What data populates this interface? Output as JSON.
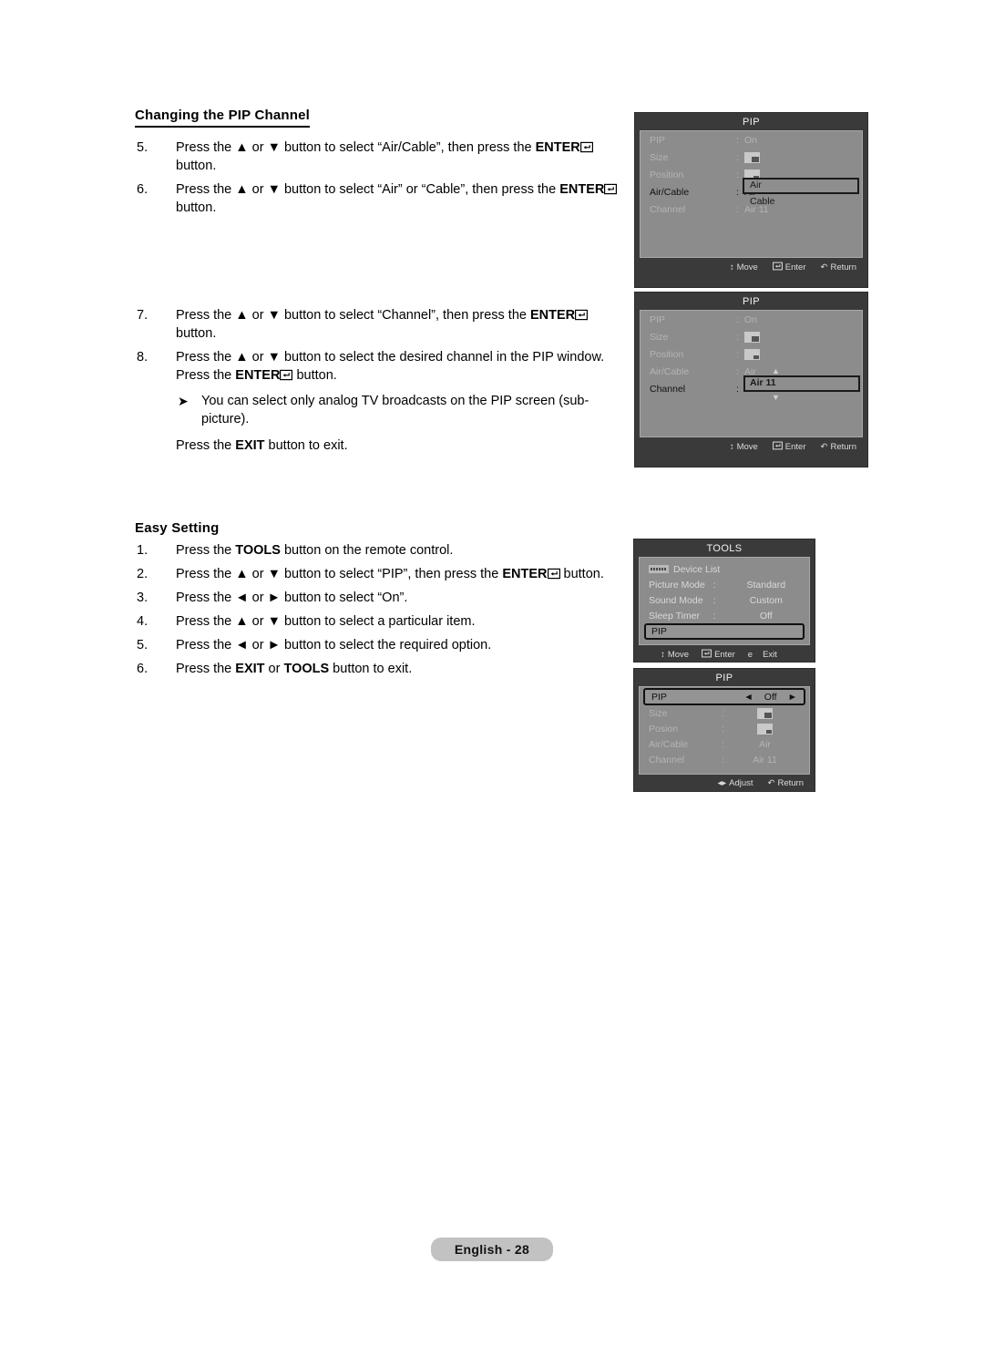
{
  "document": {
    "page_label": "English - 28"
  },
  "sections": [
    {
      "heading": "Changing the PIP Channel",
      "underlined": true,
      "steps": [
        {
          "num": "5.",
          "text_parts": [
            "Press the ▲ or ▼ button to select “Air/Cable”, then press the ",
            "ENTER",
            "enter-icon",
            " button."
          ]
        },
        {
          "num": "6.",
          "text_parts": [
            "Press the ▲ or ▼ button to select “Air” or “Cable”, then press the ",
            "ENTER",
            "enter-icon",
            " button."
          ]
        }
      ]
    },
    {
      "heading": "",
      "steps": [
        {
          "num": "7.",
          "text_parts": [
            "Press the ▲ or ▼ button to select “Channel”, then press the ",
            "ENTER",
            "enter-icon",
            " button."
          ]
        },
        {
          "num": "8.",
          "text_parts": [
            "Press the ▲ or ▼ button to select the desired channel in the PIP window. Press the ",
            "ENTER",
            "enter-icon",
            " button."
          ]
        }
      ],
      "note": "You can select only analog TV broadcasts on the PIP screen (sub-picture).",
      "note_bullet": "➤",
      "after_note_pre": "Press the ",
      "after_note_bold": "EXIT",
      "after_note_post": " button to exit."
    },
    {
      "heading": "Easy Setting",
      "underlined": false,
      "steps": [
        {
          "num": "1."
        },
        {
          "num": "2."
        },
        {
          "num": "3."
        },
        {
          "num": "4."
        },
        {
          "num": "5."
        },
        {
          "num": "6."
        }
      ]
    }
  ],
  "text": {
    "step5_a": "Press the ▲ or ▼ button to select “Air/Cable”, then press the ",
    "step5_b": "ENTER",
    "step5_c": " button.",
    "step6_a": "Press the ▲ or ▼ button to select “Air” or “Cable”, then press the ",
    "step6_b": "ENTER",
    "step6_c": " button.",
    "step7_a": "Press the ▲ or ▼ button to select “Channel”, then press the ",
    "step7_b": "ENTER",
    "step7_c": " button.",
    "step8_a": "Press the ▲ or ▼ button to select the desired channel in the PIP window. Press the ",
    "step8_b": "ENTER",
    "step8_c": " button.",
    "note8": "You can select only analog TV broadcasts on the PIP screen (sub-picture).",
    "exit_pre": "Press the ",
    "exit_bold": "EXIT",
    "exit_post": " button to exit.",
    "es1_a": "Press the ",
    "es1_b": "TOOLS",
    "es1_c": " button on the remote control.",
    "es2_a": "Press the ▲ or ▼ button to select “PIP”, then press the ",
    "es2_b": "ENTER",
    "es2_c": " button.",
    "es3": "Press the ◄ or ► button to select “On”.",
    "es4": "Press the ▲ or ▼ button to select a particular item.",
    "es5": "Press the ◄ or ► button to select the required option.",
    "es6_a": "Press the ",
    "es6_b": "EXIT",
    "es6_mid": " or ",
    "es6_c": "TOOLS",
    "es6_d": " button to exit."
  },
  "headings": {
    "changing_pip_channel": "Changing the PIP Channel",
    "easy_setting": "Easy Setting"
  },
  "numbers": {
    "n1": "1.",
    "n2": "2.",
    "n3": "3.",
    "n4": "4.",
    "n5": "5.",
    "n6": "6.",
    "n7": "7.",
    "n8": "8."
  },
  "osd_menus": [
    {
      "id": "pip-air-cable",
      "title": "PIP",
      "rows": [
        {
          "label": "PIP",
          "value": "On",
          "type": "text",
          "active": false
        },
        {
          "label": "Size",
          "value": "",
          "type": "size-icon",
          "active": false
        },
        {
          "label": "Position",
          "value": "",
          "type": "position-icon",
          "active": false
        },
        {
          "label": "Air/Cable",
          "value": "Air",
          "type": "text",
          "active": true
        },
        {
          "label": "Channel",
          "value": "Air 11",
          "type": "text",
          "active": false
        }
      ],
      "dropdown": {
        "options": [
          "Air",
          "Cable"
        ],
        "selected": "Air"
      },
      "footer": [
        {
          "icon": "updown-arrow-icon",
          "label": "Move"
        },
        {
          "icon": "enter-icon",
          "label": "Enter"
        },
        {
          "icon": "return-icon",
          "label": "Return"
        }
      ]
    },
    {
      "id": "pip-channel",
      "title": "PIP",
      "rows": [
        {
          "label": "PIP",
          "value": "On",
          "type": "text",
          "active": false
        },
        {
          "label": "Size",
          "value": "",
          "type": "size-icon",
          "active": false
        },
        {
          "label": "Position",
          "value": "",
          "type": "position-icon",
          "active": false
        },
        {
          "label": "Air/Cable",
          "value": "Air",
          "type": "text",
          "active": false
        },
        {
          "label": "Channel",
          "value": "Air 11",
          "type": "text",
          "active": true
        }
      ],
      "editor": {
        "value": "Air 11",
        "up": "▲",
        "down": "▼"
      },
      "footer": [
        {
          "icon": "updown-arrow-icon",
          "label": "Move"
        },
        {
          "icon": "enter-icon",
          "label": "Enter"
        },
        {
          "icon": "return-icon",
          "label": "Return"
        }
      ]
    },
    {
      "id": "tools",
      "title": "TOOLS",
      "rows": [
        {
          "label": "Device List",
          "value": "",
          "icon": "anynet-logo-icon",
          "active": false
        },
        {
          "label": "Picture Mode",
          "value": "Standard",
          "colon": ":",
          "active": false
        },
        {
          "label": "Sound Mode",
          "value": "Custom",
          "colon": ":",
          "active": false
        },
        {
          "label": "Sleep Timer",
          "value": "Off",
          "colon": ":",
          "active": false
        },
        {
          "label": "PIP",
          "value": "",
          "active": true
        }
      ],
      "footer": [
        {
          "icon": "updown-arrow-icon",
          "label": "Move"
        },
        {
          "icon": "enter-icon",
          "label": "Enter"
        },
        {
          "icon": "e-icon",
          "label": "Exit"
        }
      ]
    },
    {
      "id": "pip-easy",
      "title": "PIP",
      "highlight_row": {
        "label": "PIP",
        "left_arrow": "◄",
        "value": "Off",
        "right_arrow": "►"
      },
      "rows": [
        {
          "label": "Size",
          "value": "",
          "type": "size-icon",
          "colon": ":"
        },
        {
          "label": "Posion",
          "value": "",
          "type": "position-icon",
          "colon": ":"
        },
        {
          "label": "Air/Cable",
          "value": "Air",
          "type": "text",
          "colon": ":"
        },
        {
          "label": "Channel",
          "value": "Air 11",
          "type": "text",
          "colon": ":"
        }
      ],
      "footer": [
        {
          "icon": "leftright-arrow-icon",
          "label": "Adjust"
        },
        {
          "icon": "return-icon",
          "label": "Return"
        }
      ]
    }
  ]
}
